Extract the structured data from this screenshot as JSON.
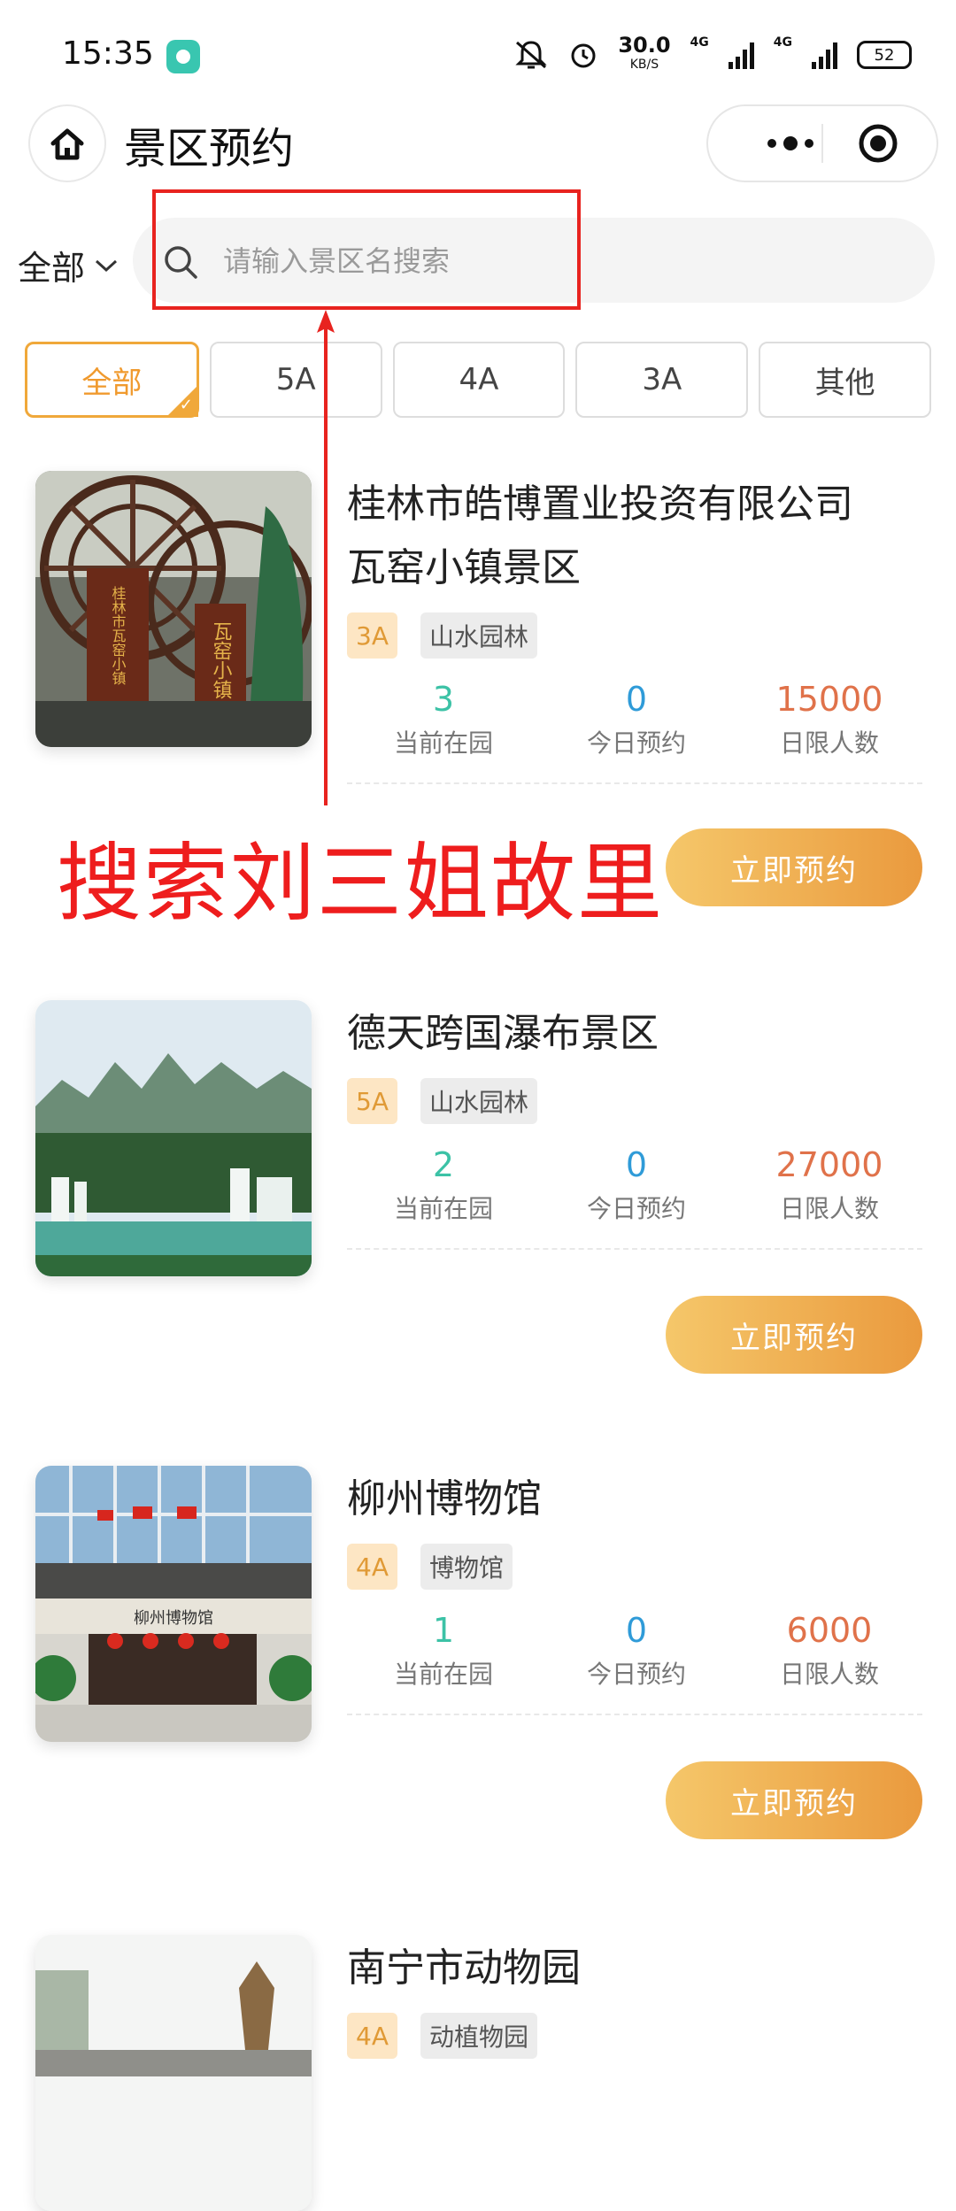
{
  "status_bar": {
    "time": "15:35",
    "speed_value": "30.0",
    "speed_unit": "KB/S",
    "net1": "4G",
    "net2": "4G",
    "battery": "52"
  },
  "header": {
    "title": "景区预约"
  },
  "search": {
    "category": "全部",
    "placeholder": "请输入景区名搜索"
  },
  "annotation": {
    "text": "搜索刘三姐故里"
  },
  "tabs": [
    {
      "label": "全部",
      "active": true
    },
    {
      "label": "5A"
    },
    {
      "label": "4A"
    },
    {
      "label": "3A"
    },
    {
      "label": "其他"
    }
  ],
  "stat_labels": {
    "in_park": "当前在园",
    "today": "今日预约",
    "limit": "日限人数"
  },
  "book_label": "立即预约",
  "scenic_list": [
    {
      "name_line1": "桂林市皓博置业投资有限公司",
      "name_line2": "瓦窑小镇景区",
      "level": "3A",
      "type": "山水园林",
      "in_park": "3",
      "today": "0",
      "limit": "15000",
      "sign_text1": "桂林市瓦窑小镇",
      "sign_text2": "瓦窑小镇"
    },
    {
      "name_line1": "德天跨国瀑布景区",
      "level": "5A",
      "type": "山水园林",
      "in_park": "2",
      "today": "0",
      "limit": "27000"
    },
    {
      "name_line1": "柳州博物馆",
      "level": "4A",
      "type": "博物馆",
      "in_park": "1",
      "today": "0",
      "limit": "6000",
      "sign_text1": "柳州博物馆"
    },
    {
      "name_line1": "南宁市动物园",
      "level": "4A",
      "type": "动植物园"
    }
  ],
  "colors": {
    "accent": "#f0a83a",
    "annotation_red": "#e8231f",
    "teal": "#3cc2a6",
    "blue": "#2f9bd8",
    "orange": "#e0724a"
  }
}
